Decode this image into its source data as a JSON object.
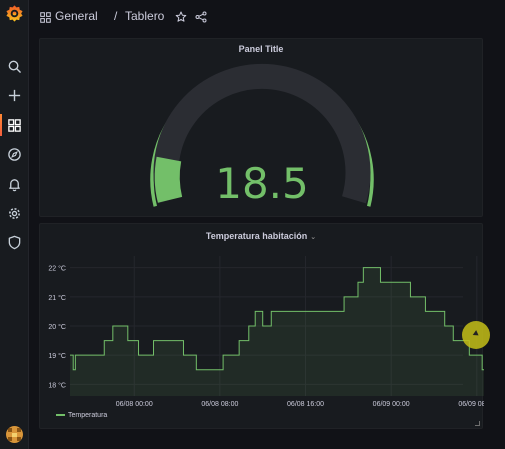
{
  "sidebar": {
    "items": [
      "grafana-logo",
      "search-icon",
      "plus-icon",
      "dashboards-icon",
      "explore-icon",
      "alerting-icon",
      "configuration-icon",
      "server-admin-icon"
    ]
  },
  "header": {
    "folder": "General",
    "separator": "/",
    "title": "Tablero"
  },
  "gauge_panel": {
    "title": "Panel Title",
    "value": "18.5",
    "color": "#73bf69",
    "threshold_color": "#73bf69"
  },
  "timeseries_panel": {
    "title": "Temperatura habitación",
    "legend": "Temperatura",
    "color": "#73bf69"
  },
  "chart_data": {
    "type": "line",
    "title": "Temperatura habitación",
    "xlabel": "",
    "ylabel": "",
    "x_tick_labels": [
      "06/08 00:00",
      "06/08 08:00",
      "06/08 16:00",
      "06/09 00:00",
      "06/09 08:00",
      "06/09 16:00"
    ],
    "y_tick_labels": [
      "18 °C",
      "19 °C",
      "20 °C",
      "21 °C",
      "22 °C"
    ],
    "y_ticks": [
      18,
      19,
      20,
      21,
      22
    ],
    "ylim": [
      17.6,
      22.4
    ],
    "x_hours_range": [
      -6,
      23
    ],
    "series": [
      {
        "name": "Temperatura",
        "x_hours": [
          -6,
          -5.7,
          -5.5,
          -5.4,
          -2.8,
          -2.0,
          -0.6,
          0.4,
          1.8,
          4.6,
          5.8,
          8.1,
          8.3,
          9.8,
          10.7,
          11.3,
          12.0,
          12.8,
          13.6,
          19.6,
          20.9,
          21.4,
          23.0,
          23.8,
          25.8,
          27.2,
          29.0,
          29.8,
          31.3,
          31.9,
          32.5,
          34.5,
          35.1,
          35.8,
          36.5,
          36.9
        ],
        "values": [
          19.0,
          18.5,
          19.0,
          19.0,
          19.5,
          20.0,
          19.5,
          19.0,
          19.5,
          19.0,
          18.5,
          18.5,
          19.0,
          19.5,
          20.0,
          20.5,
          20.0,
          20.5,
          20.5,
          21.0,
          21.5,
          22.0,
          21.5,
          21.5,
          21.0,
          20.5,
          20.0,
          19.5,
          19.0,
          19.0,
          18.5,
          18.5,
          18.0,
          18.0,
          18.5,
          18.5
        ]
      }
    ],
    "grid": true,
    "legend_position": "bottom-left"
  }
}
